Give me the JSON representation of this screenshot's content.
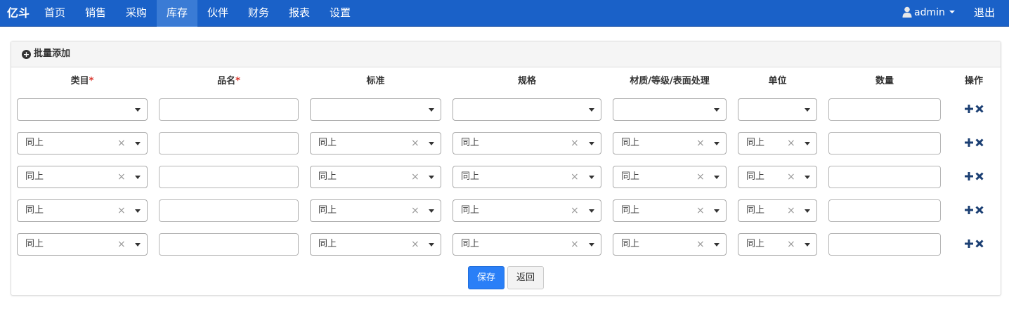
{
  "navbar": {
    "brand": "亿斗",
    "items": [
      "首页",
      "销售",
      "采购",
      "库存",
      "伙伴",
      "财务",
      "报表",
      "设置"
    ],
    "active": "库存",
    "user": "admin",
    "logout": "退出",
    "color": "#1a61c8"
  },
  "panel": {
    "title": "批量添加",
    "headers": {
      "category": "类目",
      "name": "品名",
      "standard": "标准",
      "spec": "规格",
      "material": "材质/等级/表面处理",
      "unit": "单位",
      "quantity": "数量",
      "ops": "操作"
    },
    "required_mark": "*",
    "same_as_above": "同上",
    "clear_glyph": "×"
  },
  "actions": {
    "save": "保存",
    "back": "返回",
    "save_color": "#2a7ff7"
  }
}
